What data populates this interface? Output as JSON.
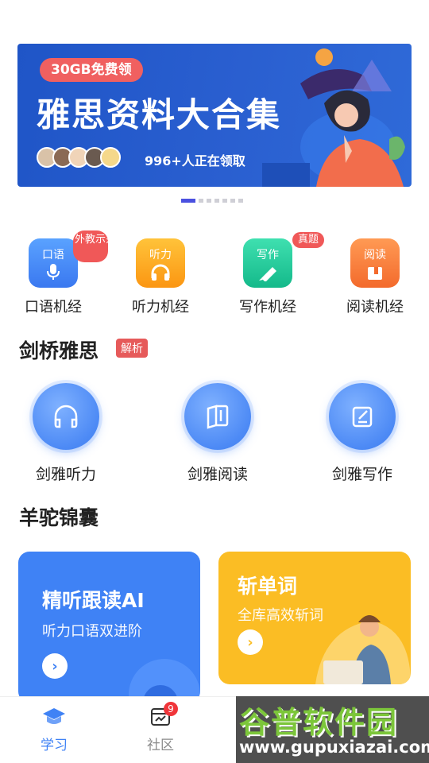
{
  "banner": {
    "tag": "30GB免费领",
    "title": "雅思资料大合集",
    "count_text": "996+人正在领取",
    "active_slide": 1,
    "total_slides": 7
  },
  "quick": [
    {
      "icon_text": "口语",
      "label": "口语机经",
      "badge": "外教示范",
      "icon": "mic-icon",
      "color": "#3a82f6"
    },
    {
      "icon_text": "听力",
      "label": "听力机经",
      "badge": "",
      "icon": "headphones-icon",
      "color": "#fca41a"
    },
    {
      "icon_text": "写作",
      "label": "写作机经",
      "badge": "真题",
      "icon": "pen-icon",
      "color": "#22c99a"
    },
    {
      "icon_text": "阅读",
      "label": "阅读机经",
      "badge": "",
      "icon": "book-icon",
      "color": "#f77b3c"
    }
  ],
  "cambridge": {
    "title": "剑桥雅思",
    "badge": "解析",
    "items": [
      {
        "label": "剑雅听力",
        "icon": "headphones-icon"
      },
      {
        "label": "剑雅阅读",
        "icon": "open-book-icon"
      },
      {
        "label": "剑雅写作",
        "icon": "edit-icon"
      }
    ]
  },
  "toolkit": {
    "title": "羊驼锦囊",
    "cards": [
      {
        "title": "精听跟读AI",
        "subtitle": "听力口语双进阶"
      },
      {
        "title": "斩单词",
        "subtitle": "全库高效斩词"
      }
    ]
  },
  "tabbar": {
    "items": [
      {
        "label": "学习",
        "icon": "graduation-cap-icon",
        "badge": ""
      },
      {
        "label": "社区",
        "icon": "chart-board-icon",
        "badge": "9"
      }
    ]
  },
  "watermark": {
    "title": "谷普软件园",
    "url": "www.gupuxiazai.com"
  },
  "colors": {
    "primary": "#3f82f5",
    "banner": "#2a5fd0",
    "badge": "#f05858",
    "yellow_card": "#fbbd24"
  }
}
